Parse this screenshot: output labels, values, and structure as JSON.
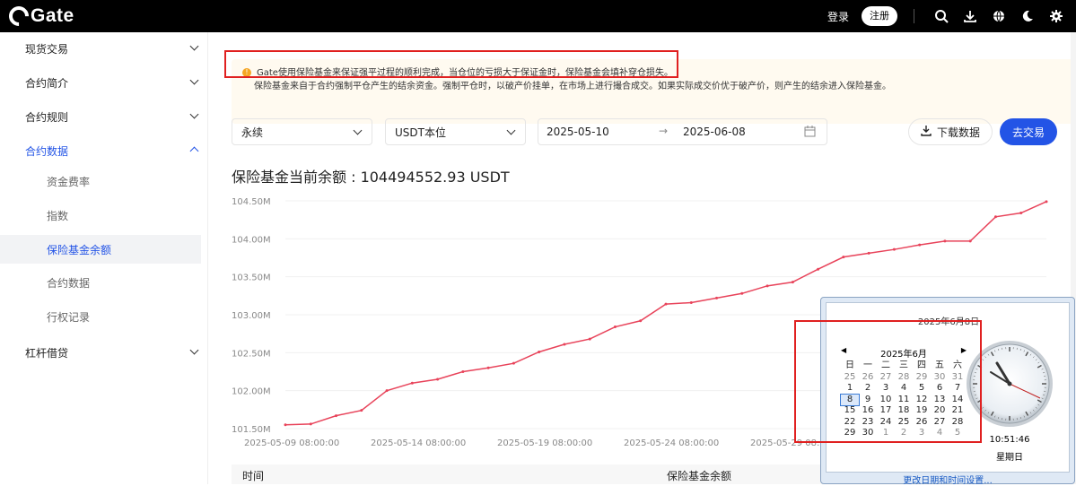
{
  "header": {
    "logo_text": "Gate",
    "login": "登录",
    "register": "注册",
    "icons": [
      "search-icon",
      "download-icon",
      "globe-icon",
      "moon-icon",
      "gear-icon"
    ]
  },
  "sidebar": {
    "items": [
      {
        "label": "现货交易"
      },
      {
        "label": "合约简介"
      },
      {
        "label": "合约规则"
      },
      {
        "label": "合约数据"
      },
      {
        "label": "杠杆借贷"
      }
    ],
    "sub_items": [
      {
        "label": "资金费率"
      },
      {
        "label": "指数"
      },
      {
        "label": "保险基金余额"
      },
      {
        "label": "合约数据"
      },
      {
        "label": "行权记录"
      }
    ]
  },
  "notice": {
    "line1": "Gate使用保险基金来保证强平过程的顺利完成，当仓位的亏损大于保证金时，保险基金会填补穿仓损失。",
    "line2": "保险基金来自于合约强制平仓产生的结余资金。强制平仓时，以破产价挂单，在市场上进行撮合成交。如果实际成交价优于破产价，则产生的结余进入保险基金。"
  },
  "filters": {
    "contract_type": "永续",
    "margin_type": "USDT本位",
    "start_date": "2025-05-10",
    "end_date": "2025-06-08",
    "download_label": "下载数据",
    "trade_label": "去交易"
  },
  "balance": {
    "title": "保险基金当前余额 : 104494552.93 USDT"
  },
  "chart_data": {
    "type": "line",
    "title": "",
    "xlabel": "",
    "ylabel": "",
    "ylim": [
      101.5,
      104.5
    ],
    "y_ticks": [
      "101.50M",
      "102.00M",
      "102.50M",
      "103.00M",
      "103.50M",
      "104.00M",
      "104.50M"
    ],
    "x_ticks": [
      "2025-05-09 08:00:00",
      "2025-05-14 08:00:00",
      "2025-05-19 08:00:00",
      "2025-05-24 08:00:00",
      "2025-05-29 08:00:00"
    ],
    "x": [
      "2025-05-10",
      "2025-05-11",
      "2025-05-12",
      "2025-05-13",
      "2025-05-14",
      "2025-05-15",
      "2025-05-16",
      "2025-05-17",
      "2025-05-18",
      "2025-05-19",
      "2025-05-20",
      "2025-05-21",
      "2025-05-22",
      "2025-05-23",
      "2025-05-24",
      "2025-05-25",
      "2025-05-26",
      "2025-05-27",
      "2025-05-28",
      "2025-05-29",
      "2025-05-30",
      "2025-05-31",
      "2025-06-01",
      "2025-06-02",
      "2025-06-03",
      "2025-06-04",
      "2025-06-05",
      "2025-06-06",
      "2025-06-07",
      "2025-06-08"
    ],
    "series": [
      {
        "color": "#e8435a",
        "values": [
          101.55,
          101.56,
          101.67,
          101.74,
          102.0,
          102.1,
          102.15,
          102.25,
          102.3,
          102.36,
          102.51,
          102.61,
          102.68,
          102.84,
          102.92,
          103.14,
          103.16,
          103.22,
          103.28,
          103.38,
          103.43,
          103.6,
          103.76,
          103.81,
          103.86,
          103.92,
          103.97,
          103.97,
          104.29,
          104.34,
          104.49
        ]
      }
    ],
    "grid": true
  },
  "table": {
    "col_time": "时间",
    "col_balance": "保险基金余额"
  },
  "popup": {
    "date_line": "2025年6月8日",
    "month_label": "2025年6月",
    "weekdays": [
      "日",
      "一",
      "二",
      "三",
      "四",
      "五",
      "六"
    ],
    "days": [
      [
        "25",
        "26",
        "27",
        "28",
        "29",
        "30",
        "31"
      ],
      [
        "1",
        "2",
        "3",
        "4",
        "5",
        "6",
        "7"
      ],
      [
        "8",
        "9",
        "10",
        "11",
        "12",
        "13",
        "14"
      ],
      [
        "15",
        "16",
        "17",
        "18",
        "19",
        "20",
        "21"
      ],
      [
        "22",
        "23",
        "24",
        "25",
        "26",
        "27",
        "28"
      ],
      [
        "29",
        "30",
        "1",
        "2",
        "3",
        "4",
        "5"
      ]
    ],
    "time": "10:51:46",
    "weekday": "星期日",
    "change_link": "更改日期和时间设置..."
  }
}
